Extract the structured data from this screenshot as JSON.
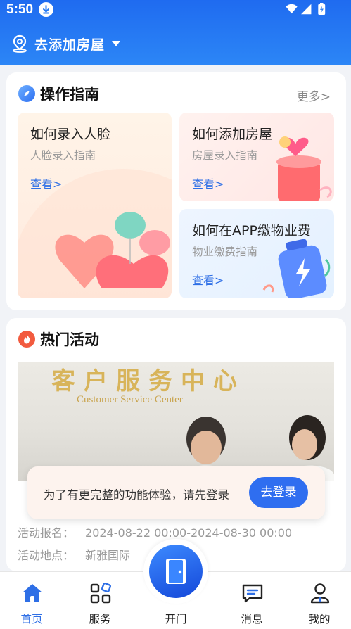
{
  "status_bar": {
    "time": "5:50",
    "icons": [
      "download-icon",
      "wifi-icon",
      "signal-icon",
      "battery-icon"
    ]
  },
  "header": {
    "location_label": "去添加房屋",
    "bg_color": "#2479f3"
  },
  "guide": {
    "title": "操作指南",
    "more": "更多>",
    "tiles": [
      {
        "title": "如何录入人脸",
        "subtitle": "人脸录入指南",
        "link": "查看>"
      },
      {
        "title": "如何添加房屋",
        "subtitle": "房屋录入指南",
        "link": "查看>"
      },
      {
        "title": "如何在APP缴物业费",
        "subtitle": "物业缴费指南",
        "link": "查看>"
      }
    ]
  },
  "activity": {
    "title": "热门活动",
    "photo_sign_cn": "客户服务中心",
    "photo_sign_en": "Customer Service Center",
    "signup_label": "活动报名：",
    "signup_value": "2024-08-22 00:00-2024-08-30 00:00",
    "location_label": "活动地点：",
    "location_value": "新雅国际"
  },
  "login_prompt": {
    "text": "为了有更完整的功能体验，请先登录",
    "button": "去登录"
  },
  "nav": {
    "home": "首页",
    "service": "服务",
    "door": "开门",
    "message": "消息",
    "mine": "我的"
  },
  "colors": {
    "accent": "#2e6fe6",
    "header": "#2479f3"
  }
}
